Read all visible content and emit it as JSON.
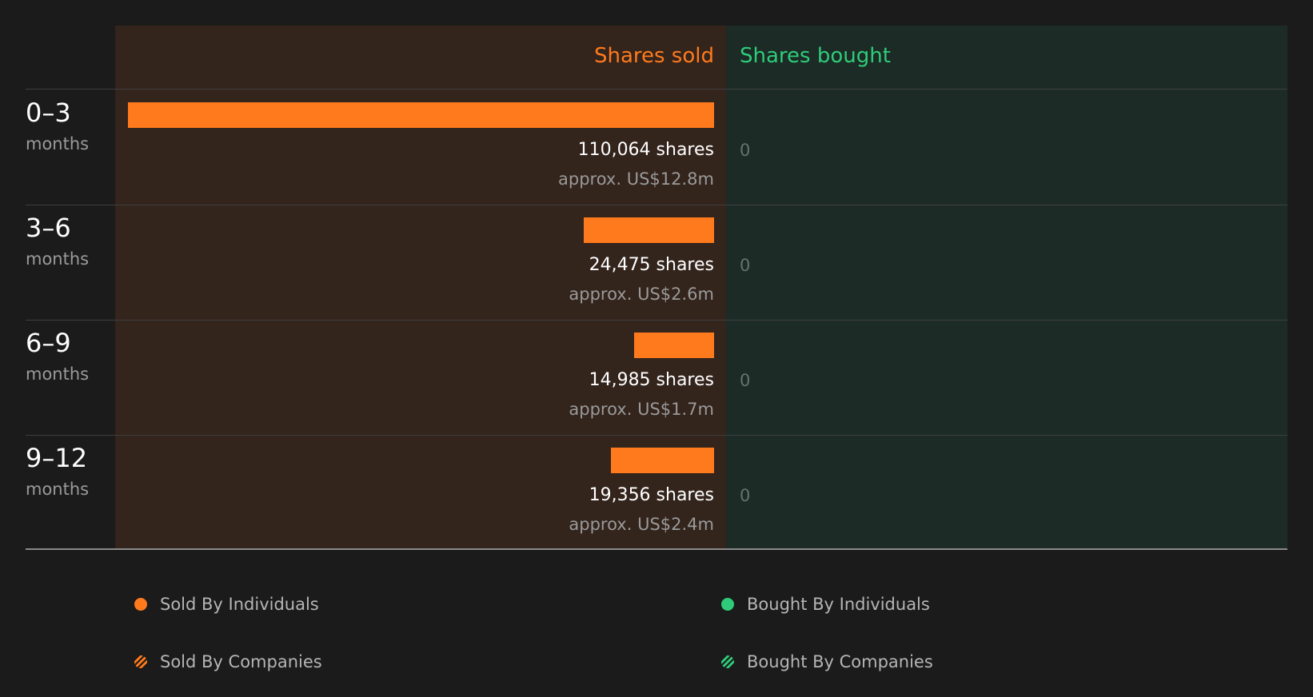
{
  "header": {
    "sold_label": "Shares sold",
    "bought_label": "Shares bought"
  },
  "colors": {
    "sold": "#ff7a1c",
    "bought": "#2ecc7a",
    "sold_panel": "#33241c",
    "bought_panel": "#1c2b25",
    "background": "#1b1b1b"
  },
  "chart_data": {
    "type": "bar",
    "orientation": "horizontal",
    "categories": [
      "0–3 months",
      "3–6 months",
      "6–9 months",
      "9–12 months"
    ],
    "series": [
      {
        "name": "Shares sold",
        "values": [
          110064,
          24475,
          14985,
          19356
        ]
      },
      {
        "name": "Shares bought",
        "values": [
          0,
          0,
          0,
          0
        ]
      }
    ],
    "xlim": [
      0,
      110064
    ]
  },
  "rows": [
    {
      "range": "0–3",
      "unit": "months",
      "sold_shares": 110064,
      "sold_shares_label": "110,064 shares",
      "sold_value_label": "approx. US$12.8m",
      "bought_label": "0"
    },
    {
      "range": "3–6",
      "unit": "months",
      "sold_shares": 24475,
      "sold_shares_label": "24,475 shares",
      "sold_value_label": "approx. US$2.6m",
      "bought_label": "0"
    },
    {
      "range": "6–9",
      "unit": "months",
      "sold_shares": 14985,
      "sold_shares_label": "14,985 shares",
      "sold_value_label": "approx. US$1.7m",
      "bought_label": "0"
    },
    {
      "range": "9–12",
      "unit": "months",
      "sold_shares": 19356,
      "sold_shares_label": "19,356 shares",
      "sold_value_label": "approx. US$2.4m",
      "bought_label": "0"
    }
  ],
  "legend": [
    {
      "label": "Sold By Individuals",
      "marker": "solid-dot",
      "color": "#ff7a1c"
    },
    {
      "label": "Bought By Individuals",
      "marker": "solid-dot",
      "color": "#2ecc7a"
    },
    {
      "label": "Sold By Companies",
      "marker": "hatched-dot",
      "color": "#ff7a1c"
    },
    {
      "label": "Bought By Companies",
      "marker": "hatched-dot",
      "color": "#2ecc7a"
    }
  ]
}
